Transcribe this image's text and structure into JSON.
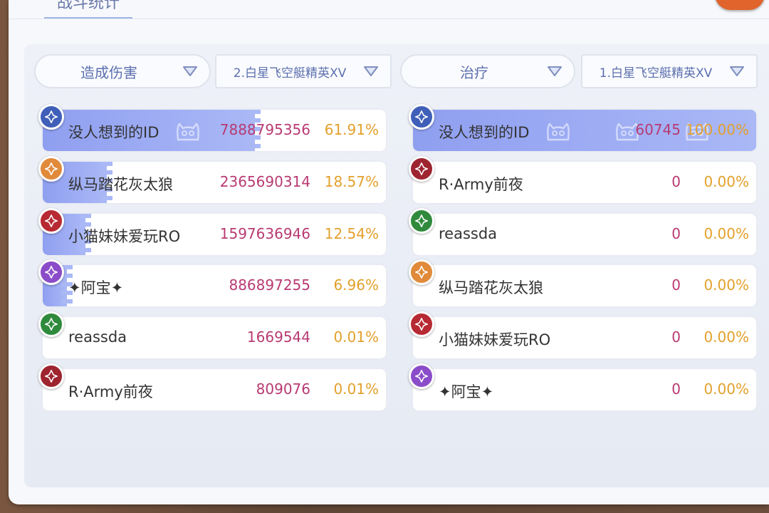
{
  "window": {
    "tab_label": "战斗统计"
  },
  "colors": {
    "accent": "#5b6fae",
    "value": "#b83a72",
    "percent": "#e3a02c",
    "bar": "#8f9ff0"
  },
  "left": {
    "stat_type": "造成伤害",
    "battle": "2.白星飞空艇精英XV",
    "rows": [
      {
        "name": "没人想到的ID",
        "value": "7888795356",
        "percent": "61.91%",
        "share": 0.619,
        "icon": "blue-knight-icon"
      },
      {
        "name": "纵马踏花灰太狼",
        "value": "2365690314",
        "percent": "18.57%",
        "share": 0.186,
        "icon": "orange-axe-icon"
      },
      {
        "name": "小猫妹妹爱玩RO",
        "value": "1597636946",
        "percent": "12.54%",
        "share": 0.125,
        "icon": "red-mage-icon"
      },
      {
        "name": "✦阿宝✦",
        "value": "886897255",
        "percent": "6.96%",
        "share": 0.07,
        "icon": "purple-rogue-icon"
      },
      {
        "name": "reassda",
        "value": "1669544",
        "percent": "0.01%",
        "share": 0.0,
        "icon": "green-archer-icon"
      },
      {
        "name": "R·Army前夜",
        "value": "809076",
        "percent": "0.01%",
        "share": 0.0,
        "icon": "red-warrior-icon"
      }
    ]
  },
  "right": {
    "stat_type": "治疗",
    "battle": "1.白星飞空艇精英XV",
    "rows": [
      {
        "name": "没人想到的ID",
        "value": "60745",
        "percent": "100.00%",
        "share": 1.0,
        "icon": "blue-knight-icon"
      },
      {
        "name": "R·Army前夜",
        "value": "0",
        "percent": "0.00%",
        "share": 0.0,
        "icon": "red-warrior-icon"
      },
      {
        "name": "reassda",
        "value": "0",
        "percent": "0.00%",
        "share": 0.0,
        "icon": "green-archer-icon"
      },
      {
        "name": "纵马踏花灰太狼",
        "value": "0",
        "percent": "0.00%",
        "share": 0.0,
        "icon": "orange-axe-icon"
      },
      {
        "name": "小猫妹妹爱玩RO",
        "value": "0",
        "percent": "0.00%",
        "share": 0.0,
        "icon": "red-mage-icon"
      },
      {
        "name": "✦阿宝✦",
        "value": "0",
        "percent": "0.00%",
        "share": 0.0,
        "icon": "purple-rogue-icon"
      }
    ]
  }
}
